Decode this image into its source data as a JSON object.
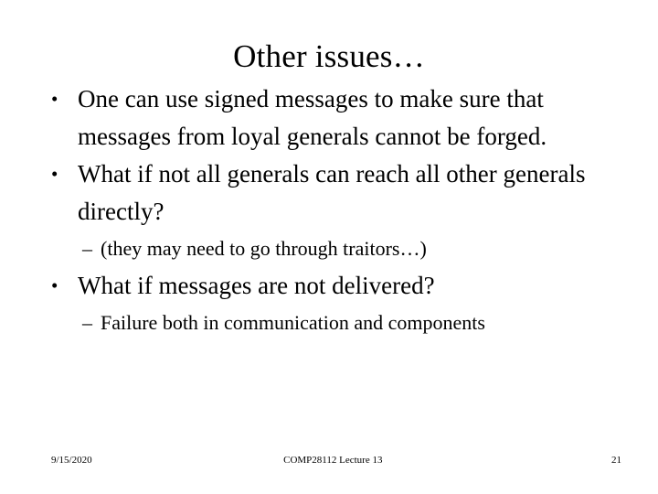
{
  "slide": {
    "title": "Other issues…",
    "background_color": "#ffffff",
    "text_color": "#000000",
    "bullet_marker": "•",
    "subbullet_marker": "–",
    "content": [
      {
        "level": 1,
        "marker": "•",
        "text": "One can use signed messages to make sure that messages from loyal generals cannot be forged."
      },
      {
        "level": 1,
        "marker": "•",
        "text": "What if not all generals can reach all other generals directly?"
      },
      {
        "level": 2,
        "marker": "–",
        "text": "(they may need to go through traitors…)"
      },
      {
        "level": 1,
        "marker": "•",
        "text": "What if messages are not delivered?"
      },
      {
        "level": 2,
        "marker": "–",
        "text": "Failure both in communication and components"
      }
    ]
  },
  "footer": {
    "date": "9/15/2020",
    "course": "COMP28112 Lecture 13",
    "page_number": "21"
  }
}
